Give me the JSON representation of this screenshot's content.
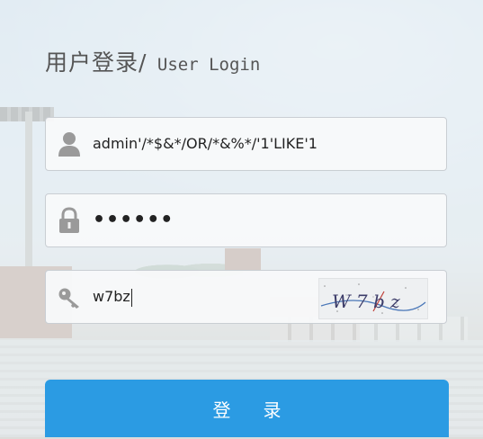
{
  "login": {
    "title_cn": "用户登录/",
    "title_en": " User Login",
    "username": {
      "icon": "user-icon",
      "value": "admin'/*$&*/OR/*&%*/'1'LIKE'1"
    },
    "password": {
      "icon": "lock-icon",
      "value": "••••••"
    },
    "captcha": {
      "icon": "key-icon",
      "value": "w7bz",
      "image_text": "W 7 b z"
    },
    "submit_label": "登录"
  },
  "colors": {
    "button": "#2b9be3",
    "title": "#555555",
    "input_border": "#c9ced3"
  }
}
